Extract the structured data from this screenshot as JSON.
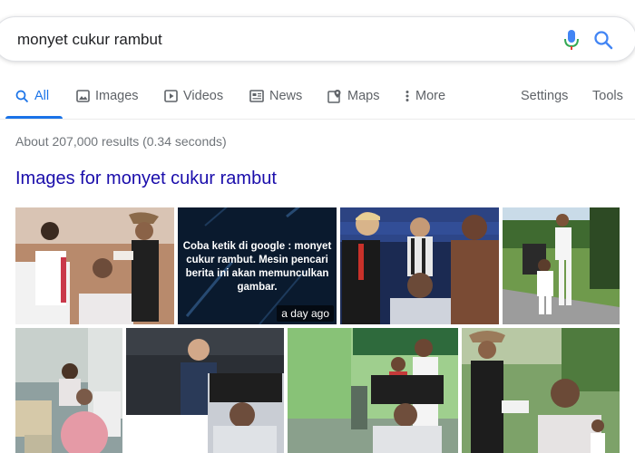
{
  "search": {
    "query": "monyet cukur rambut"
  },
  "tabs": [
    {
      "label": "All",
      "icon": "search-icon"
    },
    {
      "label": "Images",
      "icon": "image-icon"
    },
    {
      "label": "Videos",
      "icon": "play-icon"
    },
    {
      "label": "News",
      "icon": "newspaper-icon"
    },
    {
      "label": "Maps",
      "icon": "map-pin-icon"
    },
    {
      "label": "More",
      "icon": "more-vert-icon"
    }
  ],
  "tools": {
    "settings": "Settings",
    "tools": "Tools"
  },
  "result_stats": "About 207,000 results (0.34 seconds)",
  "images_heading": "Images for monyet cukur rambut",
  "thumbnails": [
    {
      "id": 1
    },
    {
      "id": 2,
      "caption": "Coba ketik di google : monyet cukur rambut. Mesin pencari berita ini akan memunculkan gambar.",
      "badge": "a day ago"
    },
    {
      "id": 3
    },
    {
      "id": 4
    },
    {
      "id": 5
    },
    {
      "id": 6
    },
    {
      "id": 7
    },
    {
      "id": 8
    }
  ],
  "colors": {
    "accent": "#1a73e8",
    "link": "#1a0dab",
    "muted": "#5f6368"
  }
}
